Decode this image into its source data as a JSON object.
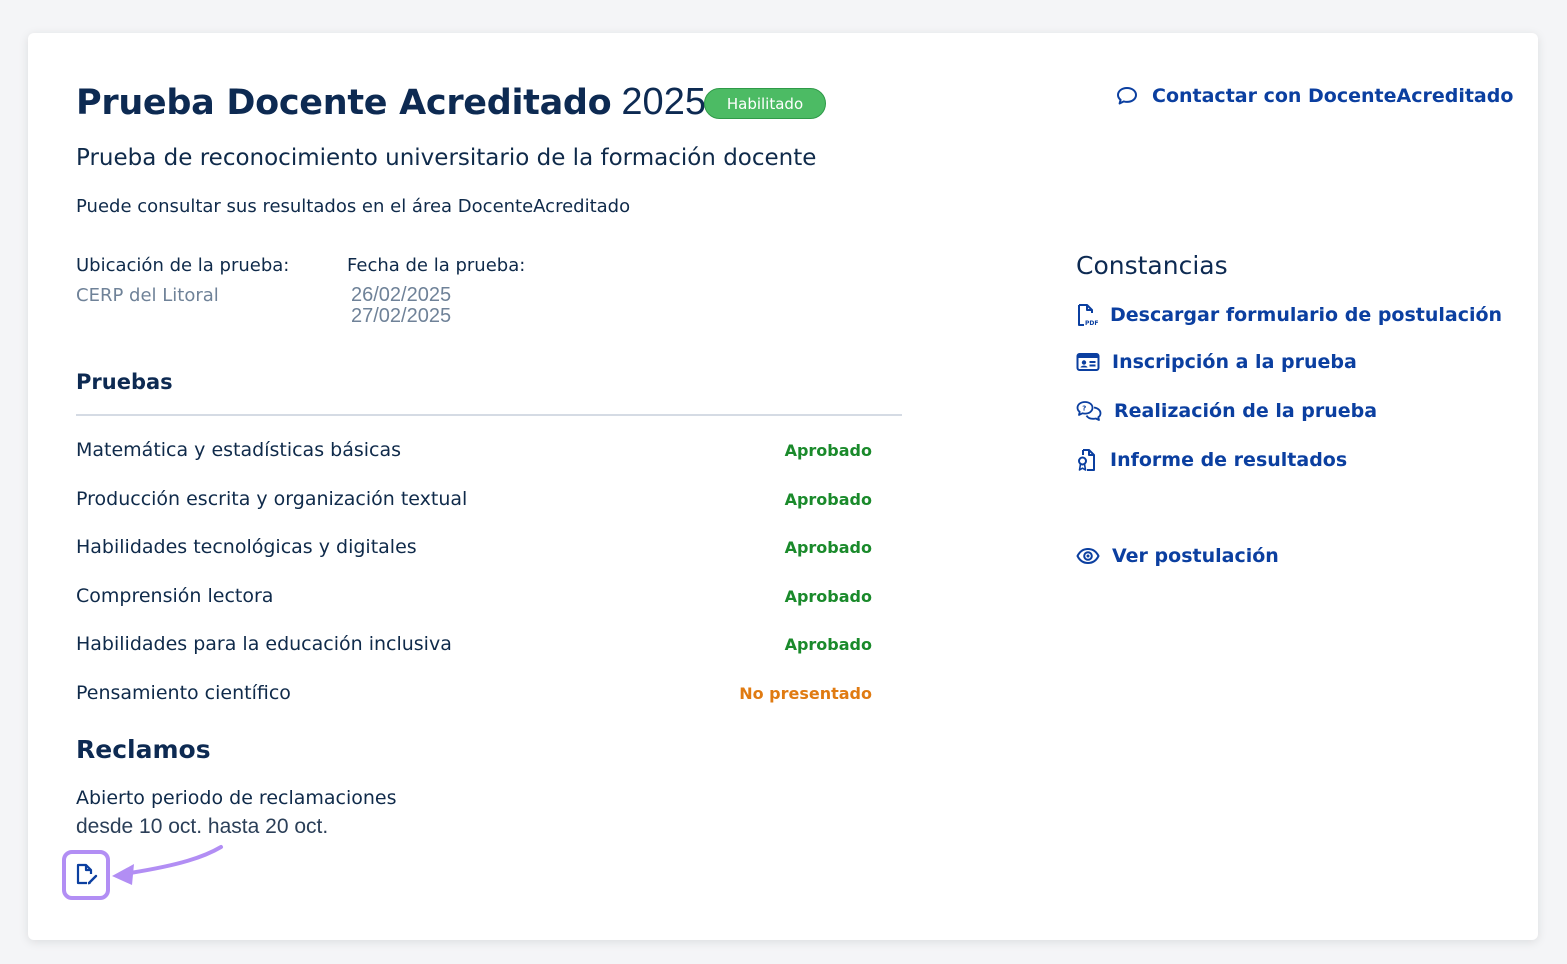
{
  "header": {
    "title": "Prueba Docente Acreditado",
    "year": "2025",
    "status_badge": "Habilitado",
    "contact_label": "Contactar con DocenteAcreditado"
  },
  "subtitle": "Prueba de reconocimiento universitario de la formación docente",
  "info_text": "Puede consultar sus resultados en el área DocenteAcreditado",
  "location": {
    "label": "Ubicación de la prueba:",
    "value": "CERP del Litoral"
  },
  "dates": {
    "label": "Fecha de la prueba:",
    "values": [
      "26/02/2025",
      "27/02/2025"
    ]
  },
  "tests": {
    "title": "Pruebas",
    "items": [
      {
        "name": "Matemática y estadísticas básicas",
        "status": "Aprobado",
        "status_color": "#1a8a2b"
      },
      {
        "name": "Producción escrita y organización textual",
        "status": "Aprobado",
        "status_color": "#1a8a2b"
      },
      {
        "name": "Habilidades tecnológicas y digitales",
        "status": "Aprobado",
        "status_color": "#1a8a2b"
      },
      {
        "name": "Comprensión lectora",
        "status": "Aprobado",
        "status_color": "#1a8a2b"
      },
      {
        "name": "Habilidades para la educación inclusiva",
        "status": "Aprobado",
        "status_color": "#1a8a2b"
      },
      {
        "name": "Pensamiento científico",
        "status": "No presentado",
        "status_color": "#e07b12"
      }
    ]
  },
  "reclamos": {
    "title": "Reclamos",
    "text": "Abierto periodo de reclamaciones",
    "range": "desde 10 oct. hasta 20 oct.",
    "action_icon": "file-edit-icon"
  },
  "constancias": {
    "title": "Constancias",
    "links": [
      {
        "label": "Descargar formulario de postulación",
        "icon": "pdf-file-icon"
      },
      {
        "label": "Inscripción a la prueba",
        "icon": "id-card-icon"
      },
      {
        "label": "Realización de la prueba",
        "icon": "chat-bubbles-icon"
      },
      {
        "label": "Informe de resultados",
        "icon": "report-file-icon"
      }
    ],
    "view_label": "Ver postulación",
    "view_icon": "eye-icon"
  },
  "colors": {
    "primary": "#0b3fa0",
    "heading": "#0d2a52",
    "approved": "#1a8a2b",
    "absent": "#e07b12",
    "badge": "#4cbb64",
    "highlight": "#b28ef4"
  }
}
